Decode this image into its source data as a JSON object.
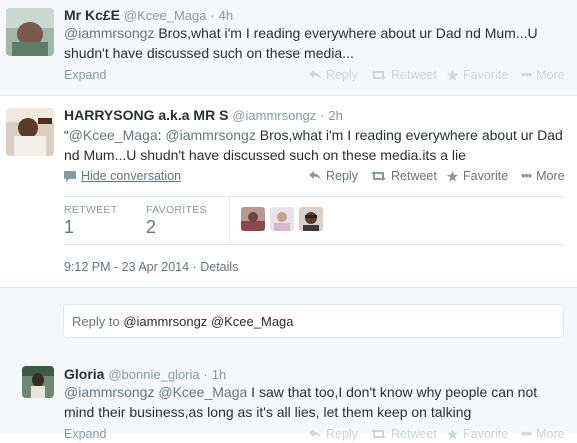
{
  "tweets": [
    {
      "name": "Mr Kc£E",
      "handle": "@Kcee_Maga",
      "time": "4h",
      "mention": "@iammrsongz",
      "text": " Bros,what i'm I reading everywhere about ur Dad nd Mum...U shudn't have discussed such on these media...",
      "expand_label": "Expand",
      "actions": {
        "reply": "Reply",
        "retweet": "Retweet",
        "favorite": "Favorite",
        "more": "More"
      }
    },
    {
      "name": "HARRYSONG a.k.a MR S",
      "handle": "@iammrsongz",
      "time": "2h",
      "text_prefix": "“",
      "mention1": "@Kcee_Maga",
      "mid": ": ",
      "mention2": "@iammrsongz",
      "text": " Bros,what i'm I reading everywhere about ur Dad nd Mum...U shudn't have discussed such on these media.its a lie",
      "hide_label": "Hide conversation",
      "actions": {
        "reply": "Reply",
        "retweet": "Retweet",
        "favorite": "Favorite",
        "more": "More"
      },
      "stats": {
        "retweet_label": "RETWEET",
        "retweet_count": "1",
        "favorites_label": "FAVORITES",
        "favorites_count": "2"
      },
      "datetime": "9:12 PM - 23 Apr 2014",
      "details_label": "Details"
    },
    {
      "name": "Gloria",
      "handle": "@bonnie_gloria",
      "time": "1h",
      "mention1": "@iammrsongz",
      "mention2": "@Kcee_Maga",
      "text": " I saw that too,I don't know why people can not mind their business,as long as it's all lies, let them keep on talking",
      "expand_label": "Expand",
      "actions": {
        "reply": "Reply",
        "retweet": "Retweet",
        "favorite": "Favorite",
        "more": "More"
      }
    }
  ],
  "reply_box": {
    "prefix": "Reply to ",
    "mention1": "@iammrsongz",
    "mention2": "@Kcee_Maga"
  },
  "colors": {
    "link": "#66757f",
    "muted": "#8899a6",
    "bg_alt": "#f5f8fa",
    "border": "#e1e8ed"
  }
}
